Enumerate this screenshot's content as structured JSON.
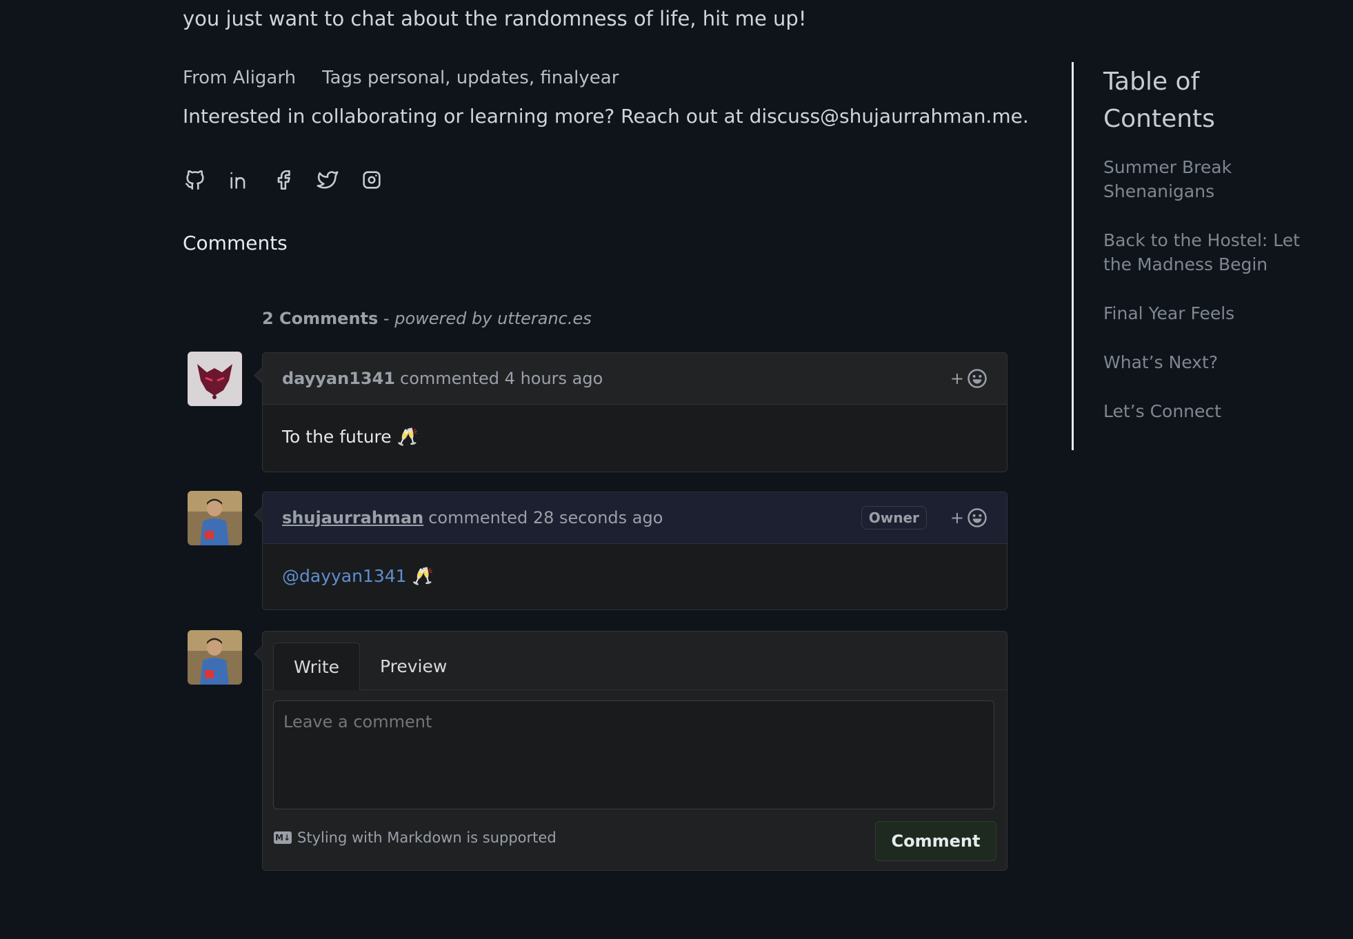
{
  "intro": {
    "text": "you just want to chat about the randomness of life, hit me up!"
  },
  "meta": {
    "from": "From Aligarh",
    "tags": "Tags personal, updates, finalyear"
  },
  "cta": {
    "text": "Interested in collaborating or learning more? Reach out at discuss@shujaurrahman.me."
  },
  "socials": [
    {
      "icon": "github-icon"
    },
    {
      "icon": "linkedin-icon"
    },
    {
      "icon": "facebook-icon"
    },
    {
      "icon": "twitter-icon"
    },
    {
      "icon": "instagram-icon"
    }
  ],
  "comments_section": {
    "heading": "Comments",
    "count_bold": "2 Comments",
    "count_sep": " - ",
    "count_italic": "powered by utteranc.es",
    "comments": [
      {
        "user": "dayyan1341",
        "action": "commented 4 hours ago",
        "body": "To the future 🥂",
        "owner": false
      },
      {
        "user": "shujaurrahman",
        "action": "commented 28 seconds ago",
        "badge": "Owner",
        "mention": "@dayyan1341",
        "body": " 🥂",
        "owner": true
      }
    ],
    "react_plus": "+"
  },
  "form": {
    "tab_write": "Write",
    "tab_preview": "Preview",
    "placeholder": "Leave a comment",
    "md_icon": "M↓",
    "md_note": "Styling with Markdown is supported",
    "submit": "Comment"
  },
  "toc": {
    "title": "Table of Contents",
    "items": [
      "Summer Break Shenanigans",
      "Back to the Hostel: Let the Madness Begin",
      "Final Year Feels",
      "What’s Next?",
      "Let’s Connect"
    ]
  },
  "colors": {
    "background": "#0f141b",
    "mention": "#5f8fcf",
    "button_bg": "#1e2a1f"
  }
}
